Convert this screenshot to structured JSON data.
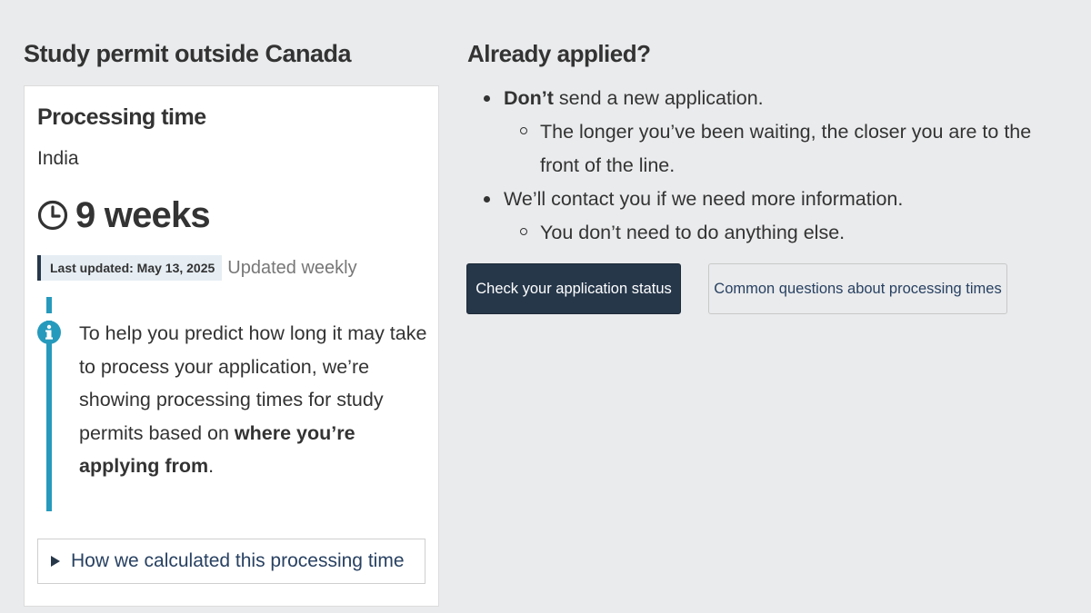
{
  "left": {
    "heading": "Study permit outside Canada",
    "card": {
      "title": "Processing time",
      "country": "India",
      "time_icon": "clock-icon",
      "time_value": "9 weeks",
      "last_updated": "Last updated: May 13, 2025",
      "update_frequency": "Updated weekly",
      "alert": {
        "icon": "info-icon",
        "text_before": "To help you predict how long it may take to process your application, we’re showing processing times for study permits based on ",
        "text_bold": "where you’re applying from",
        "text_after": "."
      },
      "details_label": "How we calculated this processing time"
    }
  },
  "right": {
    "heading": "Already applied?",
    "items": [
      {
        "bold": "Don’t",
        "text": " send a new application.",
        "sub": [
          "The longer you’ve been waiting, the closer you are to the front of the line."
        ]
      },
      {
        "bold": "",
        "text": "We’ll contact you if we need more information.",
        "sub": [
          "You don’t need to do anything else."
        ]
      }
    ],
    "buttons": {
      "primary": "Check your application status",
      "secondary": "Common questions about processing times"
    }
  },
  "colors": {
    "page_background": "#eaebed",
    "primary_button": "#26374a",
    "alert_bar": "#269abc",
    "link": "#284162"
  }
}
